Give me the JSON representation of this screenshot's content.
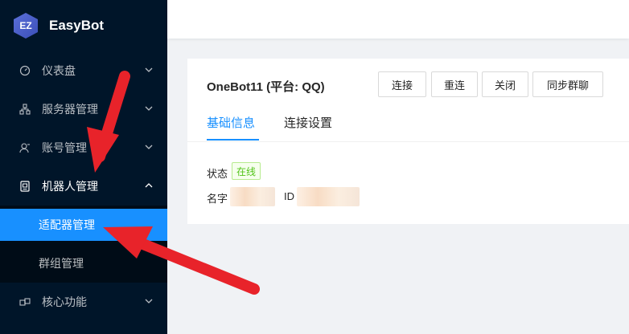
{
  "brand": {
    "logo_text": "EZ",
    "name": "EasyBot"
  },
  "sidebar": {
    "items": [
      {
        "label": "仪表盘",
        "icon": "dashboard-icon"
      },
      {
        "label": "服务器管理",
        "icon": "cluster-icon"
      },
      {
        "label": "账号管理",
        "icon": "user-icon"
      },
      {
        "label": "机器人管理",
        "icon": "robot-icon"
      },
      {
        "label": "核心功能",
        "icon": "plugin-icon"
      }
    ],
    "submenu": [
      {
        "label": "适配器管理",
        "active": true
      },
      {
        "label": "群组管理",
        "active": false
      }
    ]
  },
  "card": {
    "title": "OneBot11 (平台: QQ)",
    "buttons": [
      "连接",
      "重连",
      "关闭",
      "同步群聊"
    ],
    "tabs": [
      {
        "label": "基础信息",
        "active": true
      },
      {
        "label": "连接设置",
        "active": false
      }
    ],
    "status_label": "状态",
    "status_value": "在线",
    "name_label": "名字",
    "id_label": "ID"
  },
  "colors": {
    "sidebar_bg": "#001529",
    "accent": "#1890ff",
    "online": "#52c41a",
    "arrow": "#e8232a"
  }
}
